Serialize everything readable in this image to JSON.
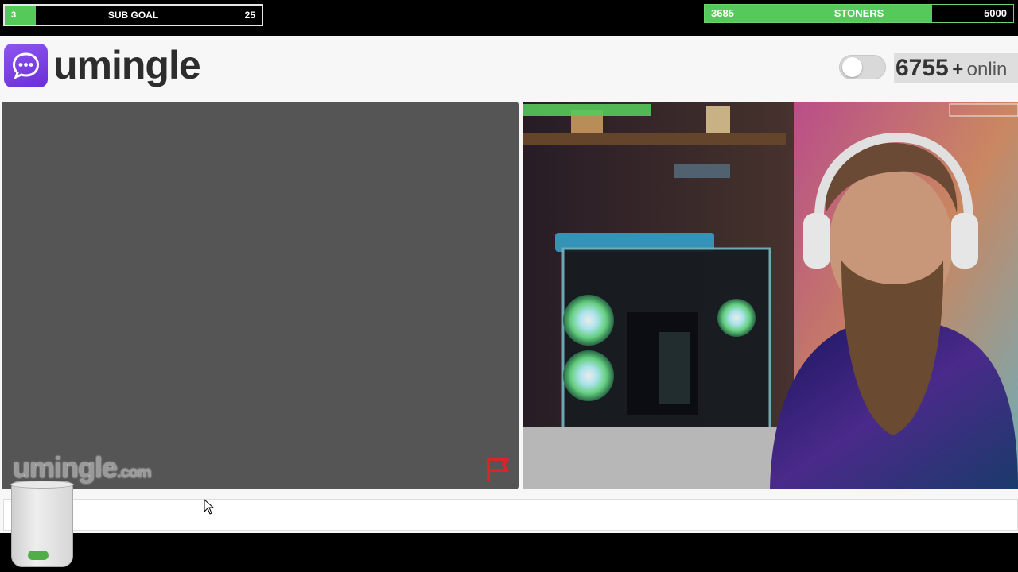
{
  "overlay": {
    "sub_goal": {
      "current": "3",
      "label": "SUB GOAL",
      "target": "25",
      "progress": 0.12
    },
    "stoners_goal": {
      "current": "3685",
      "label": "STONERS",
      "target": "5000",
      "progress": 0.737
    }
  },
  "header": {
    "brand": "umingle",
    "logo_icon": "chat-bubble-icon",
    "online_count": "6755",
    "online_plus": "+",
    "online_suffix": "onlin",
    "toggle_on": false
  },
  "left_video": {
    "watermark_name": "umingle",
    "watermark_domain": ".com",
    "flag_icon": "report-flag-icon"
  },
  "right_video": {
    "label": "stranger webcam feed"
  },
  "colors": {
    "brand_purple": "#7b3fe4",
    "goal_green": "#55c95a",
    "video_bg": "#555555",
    "flag_red": "#d6252b"
  }
}
